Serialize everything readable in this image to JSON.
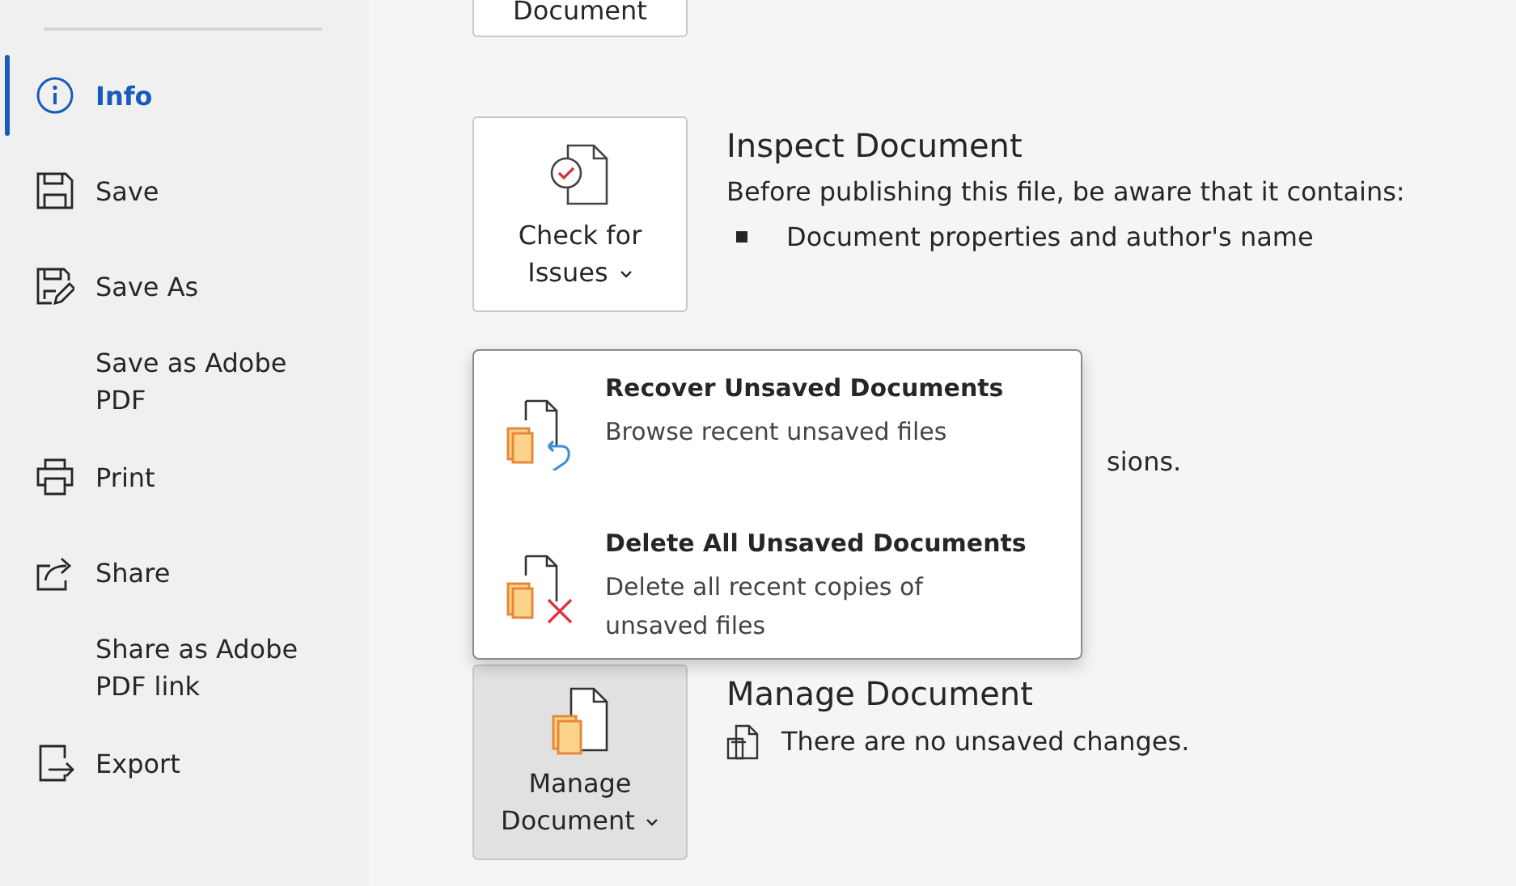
{
  "sidebar": {
    "items": [
      {
        "label": "Info",
        "selected": true
      },
      {
        "label": "Save",
        "selected": false
      },
      {
        "label": "Save As",
        "selected": false
      },
      {
        "label": "Save as Adobe PDF",
        "selected": false
      },
      {
        "label": "Print",
        "selected": false
      },
      {
        "label": "Share",
        "selected": false
      },
      {
        "label": "Share as Adobe PDF link",
        "selected": false
      },
      {
        "label": "Export",
        "selected": false
      }
    ]
  },
  "top_button": {
    "label": "Document",
    "pressed": false
  },
  "sections": [
    {
      "button": {
        "label": "Check for Issues",
        "pressed": false
      },
      "title": "Inspect Document",
      "description": "Before publishing this file, be aware that it contains:",
      "bullets": [
        "Document properties and author's name"
      ]
    },
    {
      "hidden_text": "sions."
    },
    {
      "button": {
        "label": "Manage Document",
        "pressed": true
      },
      "title": "Manage Document",
      "note": "There are no unsaved changes."
    }
  ],
  "dropdown": {
    "items": [
      {
        "kind": "recover",
        "title": "Recover Unsaved Documents",
        "description": "Browse recent unsaved files"
      },
      {
        "kind": "delete",
        "title": "Delete All Unsaved Documents",
        "description": "Delete all recent copies of unsaved files"
      }
    ]
  }
}
